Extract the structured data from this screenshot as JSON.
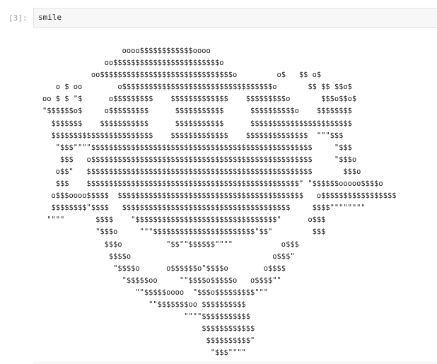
{
  "cell": {
    "prompt": "[3]:",
    "code": "smile"
  },
  "output": {
    "ascii_art": "                  oooo$$$$$$$$$$$$oooo\n              oo$$$$$$$$$$$$$$$$$$$$$$$$o\n           oo$$$$$$$$$$$$$$$$$$$$$$$$$$$$$$o         o$   $$ o$\n   o $ oo        o$$$$$$$$$$$$$$$$$$$$$$$$$$$$$$$$$$o       $$ $$ $$o$\noo $ $ \"$      o$$$$$$$$$    $$$$$$$$$$$$$    $$$$$$$$$o       $$$o$$o$\n\"$$$$$$o$     o$$$$$$$$$      $$$$$$$$$$$      $$$$$$$$$$o    $$$$$$$$\n  $$$$$$$    $$$$$$$$$$$      $$$$$$$$$$$      $$$$$$$$$$$$$$$$$$$$$$$\n  $$$$$$$$$$$$$$$$$$$$$$$    $$$$$$$$$$$$$    $$$$$$$$$$$$$$  \"\"\"$$$\n   \"$$$\"\"\"\"$$$$$$$$$$$$$$$$$$$$$$$$$$$$$$$$$$$$$$$$$$$$$$$$$$     \"$$$\n    $$$   o$$$$$$$$$$$$$$$$$$$$$$$$$$$$$$$$$$$$$$$$$$$$$$$$$$     \"$$$o\n   o$$\"   $$$$$$$$$$$$$$$$$$$$$$$$$$$$$$$$$$$$$$$$$$$$$$$$$$$       $$$o\n   $$$    $$$$$$$$$$$$$$$$$$$$$$$$$$$$$$$$$$$$$$$$$$$$$$$$\" \"$$$$$$ooooo$$$$o\n  o$$$oooo$$$$$  $$$$$$$$$$$$$$$$$$$$$$$$$$$$$$$$$$$$$$$$$$   o$$$$$$$$$$$$$$$$$\n  $$$$$$$$\"$$$$   $$$$$$$$$$$$$$$$$$$$$$$$$$$$$$$$$$$$$$     $$$$\"\"\"\"\"\"\"\"\n \"\"\"\"       $$$$    \"$$$$$$$$$$$$$$$$$$$$$$$$$$$$$$$$\"      o$$$\n            \"$$$o     \"\"\"$$$$$$$$$$$$$$$$$$$$$$$\"$$\"         $$$\n              $$$o          \"$$\"\"$$$$$$\"\"\"\"           o$$$\n               $$$$o                                o$$$\"\n                \"$$$$o      o$$$$$$o\"$$$$o        o$$$$\n                  \"$$$$$oo     \"\"$$$$o$$$$$o   o$$$$\"\"\n                     \"\"$$$$$oooo  \"$$$o$$$$$$$$$\"\"\"\n                        \"\"$$$$$$$oo $$$$$$$$$$\n                                \"\"\"\"$$$$$$$$$$$\n                                    $$$$$$$$$$$$\n                                     $$$$$$$$$$\"\n                                      \"$$$\"\"\"\""
  }
}
